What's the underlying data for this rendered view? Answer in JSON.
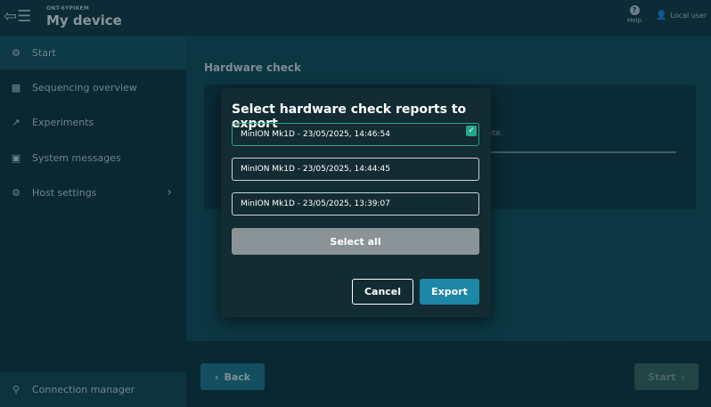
{
  "header": {
    "device_id": "ONT-6YPIKEM",
    "title": "My device",
    "help_label": "Help",
    "user_label": "Local user"
  },
  "sidebar": {
    "items": [
      {
        "label": "Start",
        "icon": "gear-icon"
      },
      {
        "label": "Sequencing overview",
        "icon": "grid-icon"
      },
      {
        "label": "Experiments",
        "icon": "trend-icon"
      },
      {
        "label": "System messages",
        "icon": "message-icon"
      },
      {
        "label": "Host settings",
        "icon": "gear-icon"
      }
    ],
    "bottom_item": {
      "label": "Connection manager",
      "icon": "network-icon"
    }
  },
  "main": {
    "title": "Hardware check",
    "card_text_fragment": "plete.",
    "back_label": "Back",
    "start_label": "Start"
  },
  "modal": {
    "title": "Select hardware check reports to export",
    "reports": [
      {
        "label": "MinION Mk1D - 23/05/2025, 14:46:54",
        "selected": true
      },
      {
        "label": "MinION Mk1D - 23/05/2025, 14:44:45",
        "selected": false
      },
      {
        "label": "MinION Mk1D - 23/05/2025, 13:39:07",
        "selected": false
      }
    ],
    "select_all_label": "Select all",
    "cancel_label": "Cancel",
    "export_label": "Export"
  },
  "colors": {
    "accent": "#1e86a6",
    "selected": "#23a68b",
    "modal_bg": "#132b33"
  }
}
